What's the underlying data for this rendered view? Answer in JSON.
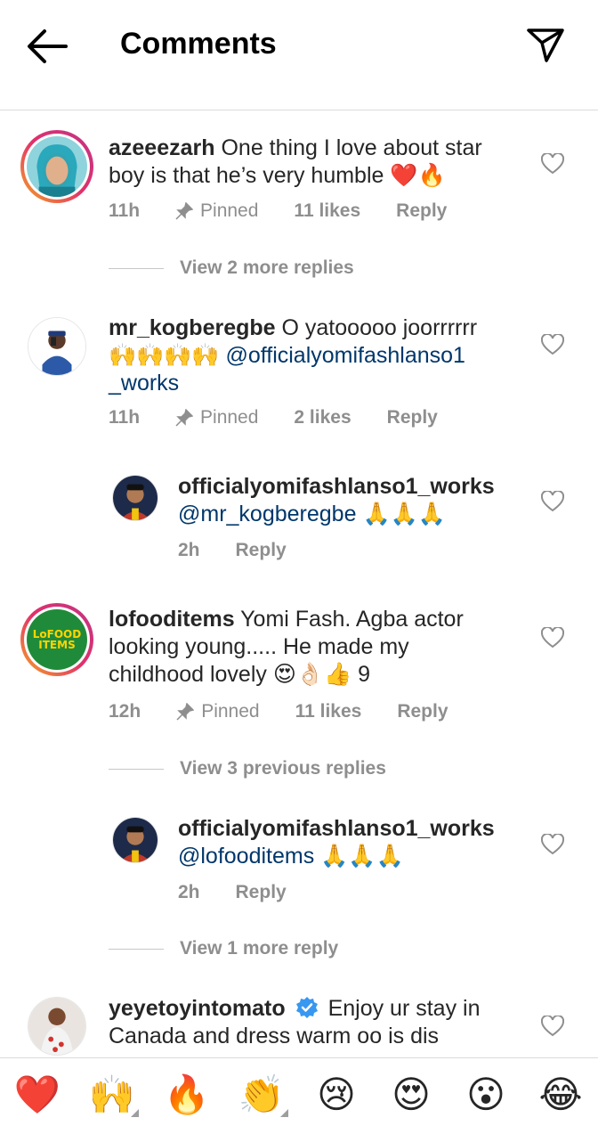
{
  "header": {
    "title": "Comments",
    "back_icon": "arrow-left-icon",
    "send_icon": "paper-plane-icon"
  },
  "comments": [
    {
      "username": "azeeezarh",
      "text": "One thing I love about star boy is that he’s very humble ❤️🔥",
      "text_line1": "One thing I love about star",
      "text_line2": "boy is that he’s very humble ❤️🔥",
      "time": "11h",
      "pinned": "Pinned",
      "likes": "11 likes",
      "reply": "Reply",
      "view_more": "View 2 more replies"
    },
    {
      "username": "mr_kogberegbe",
      "text_line1": "O yatooooo joorrrrrr",
      "text_line2_emoji": "🙌🙌🙌🙌",
      "mention": "@officialyomifashlanso1",
      "mention_line2": "_works",
      "time": "11h",
      "pinned": "Pinned",
      "likes": "2 likes",
      "reply": "Reply",
      "replies": [
        {
          "username": "officialyomifashlanso1_works",
          "mention": "@mr_kogberegbe",
          "emoji": "🙏🙏🙏",
          "time": "2h",
          "reply": "Reply"
        }
      ]
    },
    {
      "username": "lofooditems",
      "text_line1": "Yomi Fash. Agba actor",
      "text_line2": "looking young..... He made my",
      "text_line3": "childhood lovely 😍👌🏻👍 9",
      "time": "12h",
      "pinned": "Pinned",
      "likes": "11 likes",
      "reply": "Reply",
      "view_previous": "View 3 previous replies",
      "avatar_text_top": "LoFOOD",
      "avatar_text_bottom": "ITEMS",
      "replies": [
        {
          "username": "officialyomifashlanso1_works",
          "mention": "@lofooditems",
          "emoji": "🙏🙏🙏",
          "time": "2h",
          "reply": "Reply"
        }
      ],
      "view_more": "View 1 more reply"
    },
    {
      "username": "yeyetoyintomato",
      "text_line1": "Enjoy ur stay in",
      "text_line2": "Canada and dress warm oo is dis"
    }
  ],
  "emoji_bar": [
    "❤️",
    "🙌",
    "🔥",
    "👏",
    "😢",
    "😍",
    "😮",
    "😂"
  ],
  "colors": {
    "text": "#262626",
    "secondary": "#8e8e8e",
    "mention": "#00376b",
    "divider": "#dbdbdb",
    "verified": "#3897f0"
  }
}
